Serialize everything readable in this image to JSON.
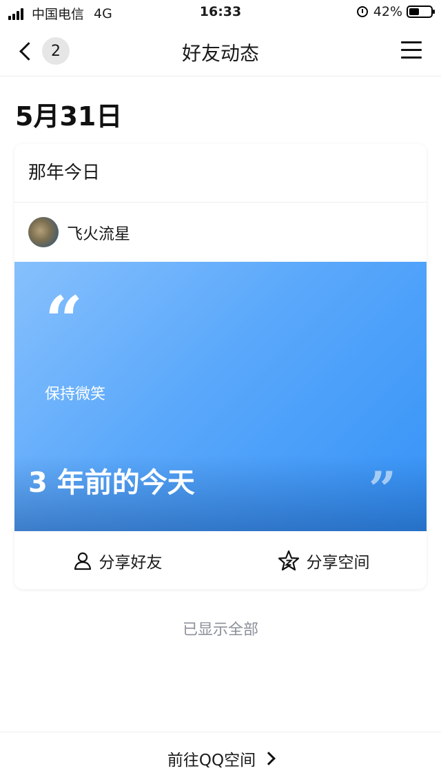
{
  "status_bar": {
    "carrier": "中国电信",
    "network": "4G",
    "time": "16:33",
    "battery": "42%"
  },
  "nav": {
    "badge": "2",
    "title": "好友动态"
  },
  "date_heading": "5月31日",
  "card": {
    "title": "那年今日",
    "author": "飞火流星",
    "quote_text": "保持微笑",
    "years_ago": "3 年前的今天",
    "share_friend": "分享好友",
    "share_space": "分享空间"
  },
  "all_shown": "已显示全部",
  "bottom_link": "前往QQ空间",
  "colors": {
    "memory_gradient_start": "#86c0fc",
    "memory_gradient_end": "#3593f7",
    "muted_text": "#8a8f99"
  }
}
